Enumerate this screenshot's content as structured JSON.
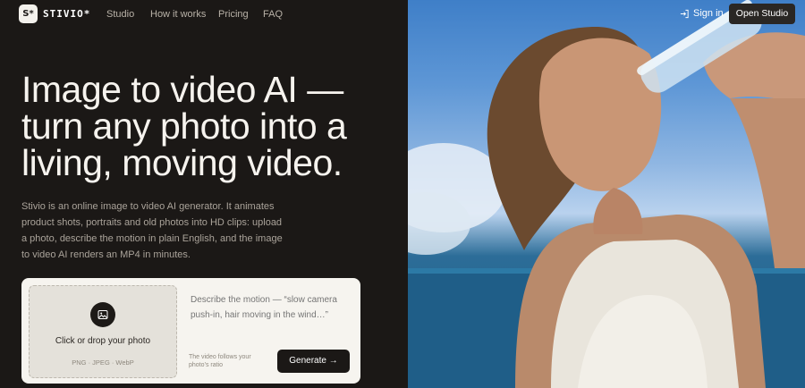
{
  "brand": {
    "badge": "S*",
    "name": "STIVIO*"
  },
  "nav": {
    "links": [
      "Studio",
      "How it works",
      "Pricing",
      "FAQ"
    ],
    "sign_in": "Sign in",
    "open_studio": "Open Studio"
  },
  "hero": {
    "headline": "Image to video AI — turn any photo into a living, moving video.",
    "description": "Stivio is an online image to video AI generator. It animates product shots, portraits and old photos into HD clips: upload a photo, describe the motion in plain English, and the image to video AI renders an MP4 in minutes."
  },
  "uploader": {
    "drop_label": "Click or drop your photo",
    "formats": "PNG · JPEG · WebP",
    "prompt_placeholder": "Describe the motion — “slow camera push-in, hair moving in the wind…”",
    "ratio_note": "The video follows your photo’s ratio",
    "generate_label": "Generate",
    "generate_arrow": "→"
  },
  "colors": {
    "background": "#1b1816",
    "accent_light": "#f6f4ef",
    "sky": "#5e97d6",
    "sea": "#1e5a82"
  }
}
